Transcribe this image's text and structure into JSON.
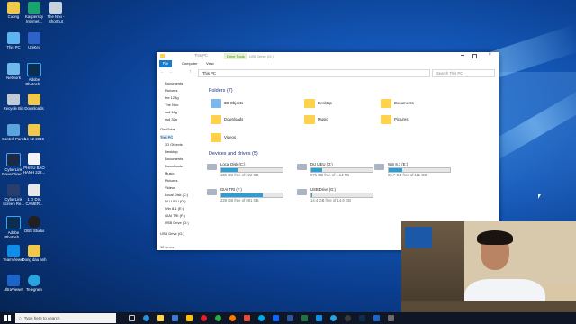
{
  "desktop_icons": [
    {
      "label": "Cuong"
    },
    {
      "label": "Kaspersky Internet..."
    },
    {
      "label": "The Nho - Shortcut"
    },
    {
      "label": "This PC"
    },
    {
      "label": "UniKey"
    },
    {
      "label": "Network"
    },
    {
      "label": "Adobe Photosh..."
    },
    {
      "label": "Recycle Bin"
    },
    {
      "label": "Downloads"
    },
    {
      "label": "Control Panel"
    },
    {
      "label": "14-12-2019"
    },
    {
      "label": "CyberLink PowerDirec..."
    },
    {
      "label": "PHIEU BAO HANH 222..."
    },
    {
      "label": "CyberLink Screen Re..."
    },
    {
      "label": "1 O DIA CAMER..."
    },
    {
      "label": "Adobe Photosh..."
    },
    {
      "label": "OBS Studio"
    },
    {
      "label": "TeamViewer"
    },
    {
      "label": "Dong dau anh"
    },
    {
      "label": "UltraViewer"
    },
    {
      "label": "Telegram"
    }
  ],
  "explorer": {
    "title": "This PC",
    "context_tab": "Drive Tools",
    "context_sub": "USB Drive (G:)",
    "menu": {
      "file": "File",
      "computer": "Computer",
      "view": "View"
    },
    "address": "This PC",
    "search_placeholder": "Search This PC",
    "nav_items": [
      "Documents",
      "Pictures",
      "the 128g",
      "The Nho",
      "ssd 16g",
      "ssd 32g",
      "OneDrive",
      "This PC",
      "3D Objects",
      "Desktop",
      "Documents",
      "Downloads",
      "Music",
      "Pictures",
      "Videos",
      "Local Disk (C:)",
      "DU LIEU (D:)",
      "Win 8.1 (E:)",
      "GIAI TRI (F:)",
      "USB Drive (G:)",
      "USB Drive (G:)"
    ],
    "folders_header": "Folders (7)",
    "folders": [
      "3D Objects",
      "Desktop",
      "Documents",
      "Downloads",
      "Music",
      "Pictures",
      "Videos"
    ],
    "drives_header": "Devices and drives (5)",
    "drives": [
      {
        "name": "Local Disk (C:)",
        "free": "165 GB free of 222 GB",
        "used_fraction": 0.26
      },
      {
        "name": "DU LIEU (D:)",
        "free": "975 GB free of 1.14 TB",
        "used_fraction": 0.17
      },
      {
        "name": "Win 8.1 (E:)",
        "free": "86.7 GB free of 111 GB",
        "used_fraction": 0.22
      },
      {
        "name": "GIAI TRI (F:)",
        "free": "228 GB free of 691 GB",
        "used_fraction": 0.67
      },
      {
        "name": "USB Drive (G:)",
        "free": "14.4 GB free of 14.6 GB",
        "used_fraction": 0.02
      }
    ],
    "status": "12 items"
  },
  "taskbar": {
    "search_placeholder": "Type here to search"
  }
}
